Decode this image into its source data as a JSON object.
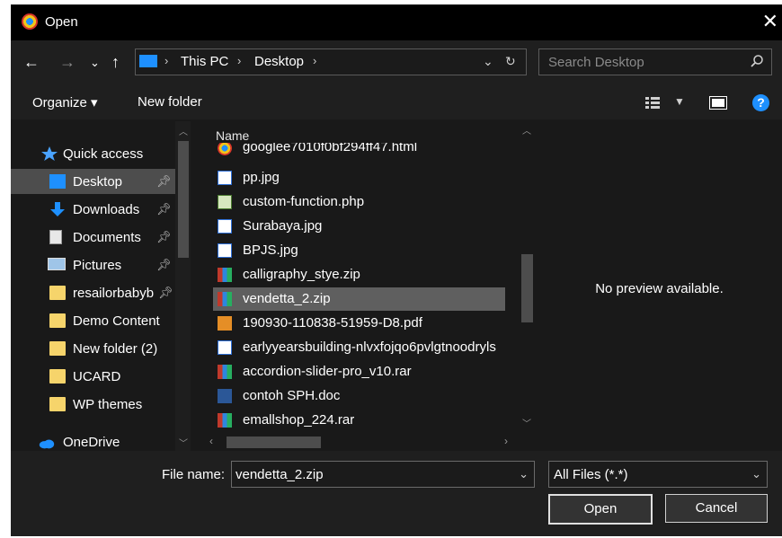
{
  "window": {
    "title": "Open",
    "close_label": "✕"
  },
  "nav": {
    "back": "←",
    "forward": "→",
    "recent": "⌄",
    "up": "↑",
    "breadcrumb": [
      "This PC",
      "Desktop"
    ],
    "search_placeholder": "Search Desktop"
  },
  "toolbar": {
    "organize_label": "Organize ▾",
    "new_folder_label": "New folder",
    "help_label": "?"
  },
  "sidebar": {
    "items": [
      {
        "label": "Quick access",
        "icon": "star-icon"
      },
      {
        "label": "Desktop",
        "icon": "desktop-icon",
        "pinned": true,
        "selected": true
      },
      {
        "label": "Downloads",
        "icon": "download-icon",
        "pinned": true
      },
      {
        "label": "Documents",
        "icon": "document-icon",
        "pinned": true
      },
      {
        "label": "Pictures",
        "icon": "pictures-icon",
        "pinned": true
      },
      {
        "label": "resailorbabyb",
        "icon": "folder-icon",
        "pinned": true
      },
      {
        "label": "Demo Content",
        "icon": "folder-icon"
      },
      {
        "label": "New folder (2)",
        "icon": "folder-icon"
      },
      {
        "label": "UCARD",
        "icon": "folder-icon"
      },
      {
        "label": "WP themes",
        "icon": "folder-icon"
      },
      {
        "label": "OneDrive",
        "icon": "cloud-icon"
      }
    ]
  },
  "file_list": {
    "column_header": "Name",
    "files": [
      {
        "name": "googlee7010f0bf294ff47.html",
        "icon": "chrome-icon"
      },
      {
        "name": "pp.jpg",
        "icon": "image-icon"
      },
      {
        "name": "custom-function.php",
        "icon": "php-icon"
      },
      {
        "name": "Surabaya.jpg",
        "icon": "image-icon"
      },
      {
        "name": "BPJS.jpg",
        "icon": "image-icon"
      },
      {
        "name": "calligraphy_stye.zip",
        "icon": "archive-icon"
      },
      {
        "name": "vendetta_2.zip",
        "icon": "archive-icon",
        "selected": true
      },
      {
        "name": "190930-110838-51959-D8.pdf",
        "icon": "pdf-icon"
      },
      {
        "name": "earlyyearsbuilding-nlvxfojqo6pvlgtnoodryls",
        "icon": "image-icon"
      },
      {
        "name": "accordion-slider-pro_v10.rar",
        "icon": "archive-icon"
      },
      {
        "name": "contoh SPH.doc",
        "icon": "word-icon"
      },
      {
        "name": "emallshop_224.rar",
        "icon": "archive-icon"
      }
    ]
  },
  "preview": {
    "text": "No preview available."
  },
  "footer": {
    "file_name_label": "File name:",
    "file_name_value": "vendetta_2.zip",
    "filter_value": "All Files (*.*)",
    "open_label": "Open",
    "cancel_label": "Cancel"
  },
  "colors": {
    "accent": "#1e90ff",
    "background": "#191919",
    "selection": "#5f5f5f",
    "folder": "#f6d46b"
  }
}
